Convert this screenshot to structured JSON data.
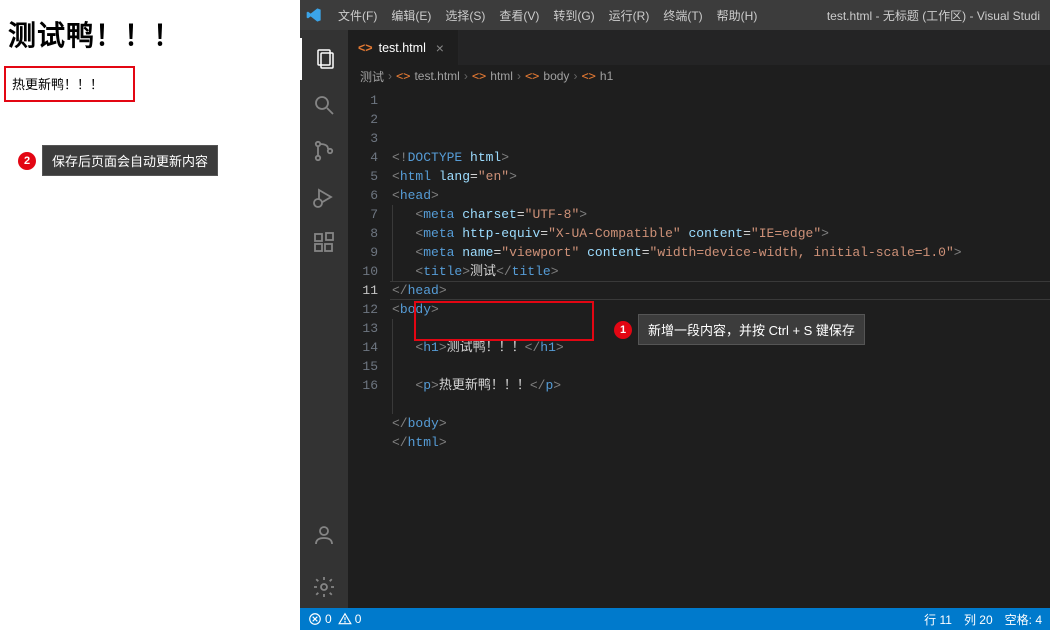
{
  "preview": {
    "h1": "测试鸭！！！",
    "p": "热更新鸭！！！"
  },
  "callouts": {
    "c1": {
      "num": "1",
      "text": "新增一段内容，并按 Ctrl + S 键保存"
    },
    "c2": {
      "num": "2",
      "text": "保存后页面会自动更新内容"
    }
  },
  "titlebar": {
    "menus": [
      "文件(F)",
      "编辑(E)",
      "选择(S)",
      "查看(V)",
      "转到(G)",
      "运行(R)",
      "终端(T)",
      "帮助(H)"
    ],
    "title": "test.html - 无标题 (工作区) - Visual Studi"
  },
  "tab": {
    "name": "test.html",
    "icon": "<>"
  },
  "breadcrumb": {
    "root": "测试",
    "parts": [
      "test.html",
      "html",
      "body",
      "h1"
    ]
  },
  "code": {
    "current_line": 11,
    "lines": [
      {
        "n": 1,
        "indent": 0,
        "tokens": [
          [
            "brk",
            "<!"
          ],
          [
            "doc",
            "DOCTYPE "
          ],
          [
            "attr",
            "html"
          ],
          [
            "brk",
            ">"
          ]
        ]
      },
      {
        "n": 2,
        "indent": 0,
        "tokens": [
          [
            "brk",
            "<"
          ],
          [
            "tag",
            "html "
          ],
          [
            "attr",
            "lang"
          ],
          [
            "txt",
            "="
          ],
          [
            "str",
            "\"en\""
          ],
          [
            "brk",
            ">"
          ]
        ]
      },
      {
        "n": 3,
        "indent": 0,
        "tokens": [
          [
            "brk",
            "<"
          ],
          [
            "tag",
            "head"
          ],
          [
            "brk",
            ">"
          ]
        ]
      },
      {
        "n": 4,
        "indent": 1,
        "tokens": [
          [
            "brk",
            "<"
          ],
          [
            "tag",
            "meta "
          ],
          [
            "attr",
            "charset"
          ],
          [
            "txt",
            "="
          ],
          [
            "str",
            "\"UTF-8\""
          ],
          [
            "brk",
            ">"
          ]
        ]
      },
      {
        "n": 5,
        "indent": 1,
        "tokens": [
          [
            "brk",
            "<"
          ],
          [
            "tag",
            "meta "
          ],
          [
            "attr",
            "http-equiv"
          ],
          [
            "txt",
            "="
          ],
          [
            "str",
            "\"X-UA-Compatible\""
          ],
          [
            "txt",
            " "
          ],
          [
            "attr",
            "content"
          ],
          [
            "txt",
            "="
          ],
          [
            "str",
            "\"IE=edge\""
          ],
          [
            "brk",
            ">"
          ]
        ]
      },
      {
        "n": 6,
        "indent": 1,
        "tokens": [
          [
            "brk",
            "<"
          ],
          [
            "tag",
            "meta "
          ],
          [
            "attr",
            "name"
          ],
          [
            "txt",
            "="
          ],
          [
            "str",
            "\"viewport\""
          ],
          [
            "txt",
            " "
          ],
          [
            "attr",
            "content"
          ],
          [
            "txt",
            "="
          ],
          [
            "str",
            "\"width=device-width, initial-scale=1.0\""
          ],
          [
            "brk",
            ">"
          ]
        ]
      },
      {
        "n": 7,
        "indent": 1,
        "tokens": [
          [
            "brk",
            "<"
          ],
          [
            "tag",
            "title"
          ],
          [
            "brk",
            ">"
          ],
          [
            "txt",
            "测试"
          ],
          [
            "brk",
            "</"
          ],
          [
            "tag",
            "title"
          ],
          [
            "brk",
            ">"
          ]
        ]
      },
      {
        "n": 8,
        "indent": 0,
        "tokens": [
          [
            "brk",
            "</"
          ],
          [
            "tag",
            "head"
          ],
          [
            "brk",
            ">"
          ]
        ]
      },
      {
        "n": 9,
        "indent": 0,
        "tokens": [
          [
            "brk",
            "<"
          ],
          [
            "tag",
            "body"
          ],
          [
            "brk",
            ">"
          ]
        ]
      },
      {
        "n": 10,
        "indent": 1,
        "tokens": []
      },
      {
        "n": 11,
        "indent": 1,
        "tokens": [
          [
            "brk",
            "<"
          ],
          [
            "tag",
            "h1"
          ],
          [
            "brk",
            ">"
          ],
          [
            "txt",
            "测试鸭！！！"
          ],
          [
            "brk",
            "</"
          ],
          [
            "tag",
            "h1"
          ],
          [
            "brk",
            ">"
          ]
        ]
      },
      {
        "n": 12,
        "indent": 1,
        "tokens": []
      },
      {
        "n": 13,
        "indent": 1,
        "tokens": [
          [
            "brk",
            "<"
          ],
          [
            "tag",
            "p"
          ],
          [
            "brk",
            ">"
          ],
          [
            "txt",
            "热更新鸭！！！"
          ],
          [
            "brk",
            "</"
          ],
          [
            "tag",
            "p"
          ],
          [
            "brk",
            ">"
          ]
        ]
      },
      {
        "n": 14,
        "indent": 1,
        "tokens": []
      },
      {
        "n": 15,
        "indent": 0,
        "tokens": [
          [
            "brk",
            "</"
          ],
          [
            "tag",
            "body"
          ],
          [
            "brk",
            ">"
          ]
        ]
      },
      {
        "n": 16,
        "indent": 0,
        "tokens": [
          [
            "brk",
            "</"
          ],
          [
            "tag",
            "html"
          ],
          [
            "brk",
            ">"
          ]
        ]
      }
    ]
  },
  "statusbar": {
    "errors": "0",
    "warnings": "0",
    "line": "行 11",
    "col": "列 20",
    "spaces": "空格: 4"
  }
}
